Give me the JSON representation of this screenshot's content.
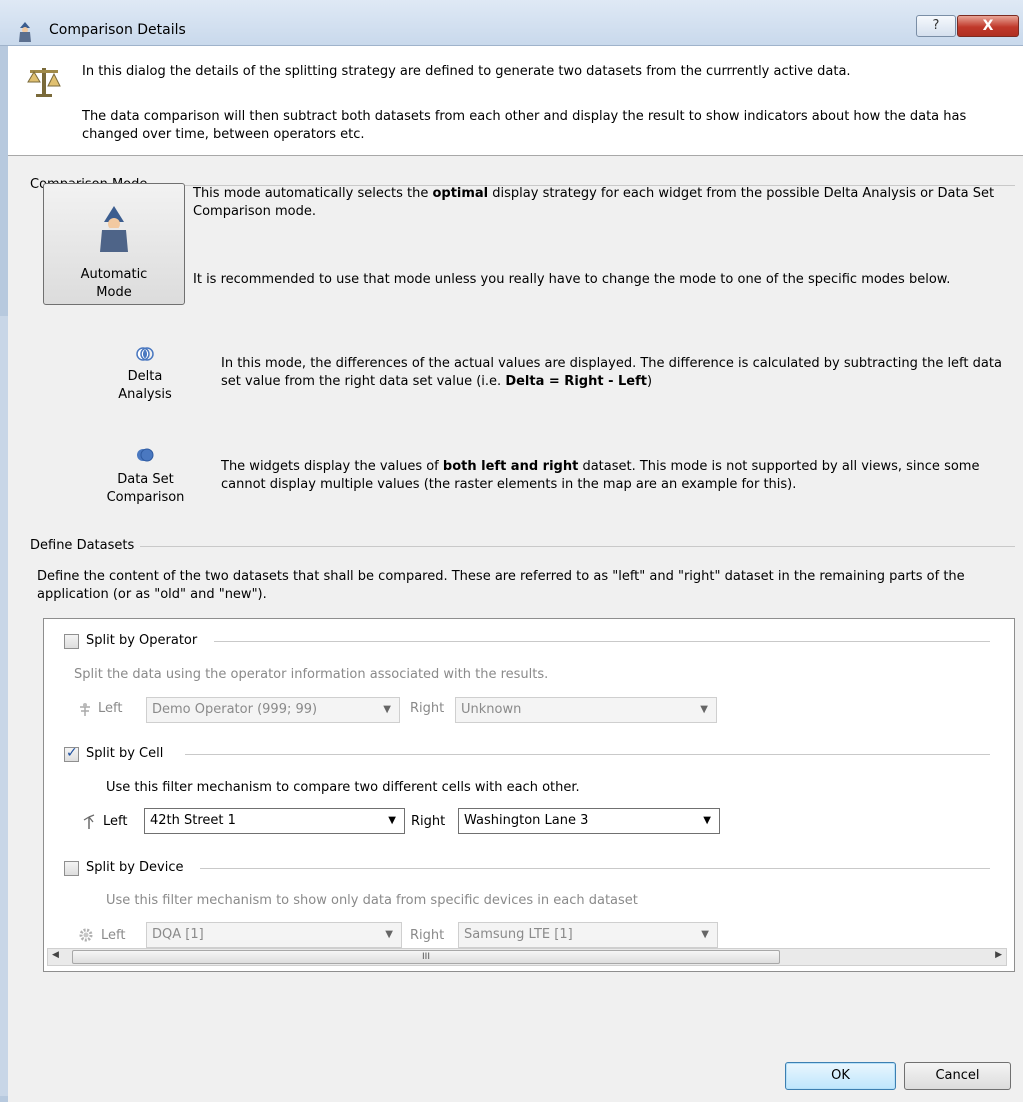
{
  "window": {
    "title": "Comparison Details",
    "help_label": "?",
    "close_label": "X"
  },
  "info": {
    "line1": "In this dialog the details of the splitting strategy are defined to generate two datasets from the currrently active data.",
    "line2": "The data comparison will then subtract both datasets from each other and display the result to show indicators about how the data has changed over time, between operators etc."
  },
  "comparison_mode": {
    "title": "Comparison Mode",
    "automatic": {
      "label_line1": "Automatic",
      "label_line2": "Mode",
      "desc1_pre": "This mode automatically selects the ",
      "desc1_bold": "optimal",
      "desc1_post": " display strategy for each widget from the possible Delta Analysis or Data Set Comparison mode.",
      "desc2": "It is recommended to use that mode unless you really have to change the mode to one of the specific modes below."
    },
    "delta": {
      "label_line1": "Delta",
      "label_line2": "Analysis",
      "desc_pre": "In this mode, the differences of the actual values are displayed. The difference is calculated by subtracting the left data set value from the right data set value (i.e. ",
      "desc_bold": "Delta = Right - Left",
      "desc_post": ")"
    },
    "dataset": {
      "label_line1": "Data Set",
      "label_line2": "Comparison",
      "desc_pre": "The widgets display the values of ",
      "desc_bold": "both left and right",
      "desc_post": " dataset. This mode is not supported by all views, since some cannot display multiple values (the raster elements in the map are an example for this)."
    }
  },
  "define_datasets": {
    "title": "Define Datasets",
    "description": "Define the content of the two datasets that shall be compared. These are referred to as \"left\" and \"right\" dataset in the remaining parts of the application (or as \"old\" and \"new\").",
    "operator": {
      "label": "Split by Operator",
      "checked": false,
      "desc": "Split the data using the operator information associated with the results.",
      "left_label": "Left",
      "left_value": "Demo Operator (999; 99)",
      "right_label": "Right",
      "right_value": "Unknown"
    },
    "cell": {
      "label": "Split by Cell",
      "checked": true,
      "desc": "Use this filter mechanism to compare two different cells with each other.",
      "left_label": "Left",
      "left_value": "42th Street 1",
      "right_label": "Right",
      "right_value": "Washington Lane 3"
    },
    "device": {
      "label": "Split by Device",
      "checked": false,
      "desc": "Use this filter mechanism to show only data from specific devices in each dataset",
      "left_label": "Left",
      "left_value": "DQA [1]",
      "right_label": "Right",
      "right_value": "Samsung LTE [1]"
    },
    "scrollbar_thumb": "III"
  },
  "buttons": {
    "ok": "OK",
    "cancel": "Cancel"
  }
}
